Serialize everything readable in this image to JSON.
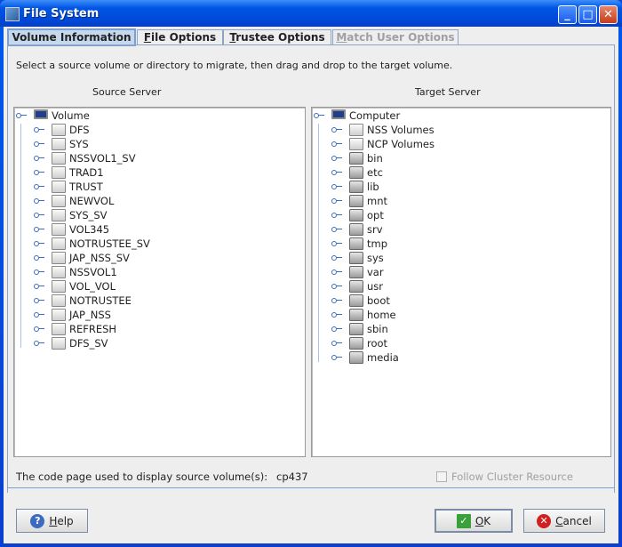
{
  "window": {
    "title": "File System"
  },
  "tabs": [
    {
      "label": "Volume Information",
      "mnemonic": "",
      "rest": "Volume Information"
    },
    {
      "label": "File Options",
      "mnemonic": "F",
      "rest": "ile Options"
    },
    {
      "label": "Trustee Options",
      "mnemonic": "T",
      "rest": "rustee Options"
    },
    {
      "label": "Match User Options",
      "mnemonic": "M",
      "rest": "atch User Options"
    }
  ],
  "instruction": "Select a source volume or directory to migrate, then drag and drop to the target volume.",
  "source": {
    "header": "Source Server",
    "root": "Volume",
    "items": [
      "DFS",
      "SYS",
      "NSSVOL1_SV",
      "TRAD1",
      "TRUST",
      "NEWVOL",
      "SYS_SV",
      "VOL345",
      "NOTRUSTEE_SV",
      "JAP_NSS_SV",
      "NSSVOL1",
      "VOL_VOL",
      "NOTRUSTEE",
      "JAP_NSS",
      "REFRESH",
      "DFS_SV"
    ]
  },
  "target": {
    "header": "Target Server",
    "root": "Computer",
    "items": [
      {
        "label": "NSS Volumes",
        "icon": "drive"
      },
      {
        "label": "NCP Volumes",
        "icon": "drive"
      },
      {
        "label": "bin",
        "icon": "folder"
      },
      {
        "label": "etc",
        "icon": "folder"
      },
      {
        "label": "lib",
        "icon": "folder"
      },
      {
        "label": "mnt",
        "icon": "folder"
      },
      {
        "label": "opt",
        "icon": "folder"
      },
      {
        "label": "srv",
        "icon": "folder"
      },
      {
        "label": "tmp",
        "icon": "folder"
      },
      {
        "label": "sys",
        "icon": "folder"
      },
      {
        "label": "var",
        "icon": "folder"
      },
      {
        "label": "usr",
        "icon": "folder"
      },
      {
        "label": "boot",
        "icon": "folder"
      },
      {
        "label": "home",
        "icon": "folder"
      },
      {
        "label": "sbin",
        "icon": "folder"
      },
      {
        "label": "root",
        "icon": "folder"
      },
      {
        "label": "media",
        "icon": "folder"
      }
    ]
  },
  "codepage": {
    "label": "The code page used to display source volume(s):",
    "value": "cp437"
  },
  "follow_cluster": {
    "label": "Follow Cluster Resource",
    "checked": false,
    "enabled": false
  },
  "buttons": {
    "help": {
      "m": "H",
      "rest": "elp"
    },
    "ok": {
      "m": "O",
      "rest": "K"
    },
    "cancel": {
      "m": "C",
      "rest": "ancel"
    }
  }
}
